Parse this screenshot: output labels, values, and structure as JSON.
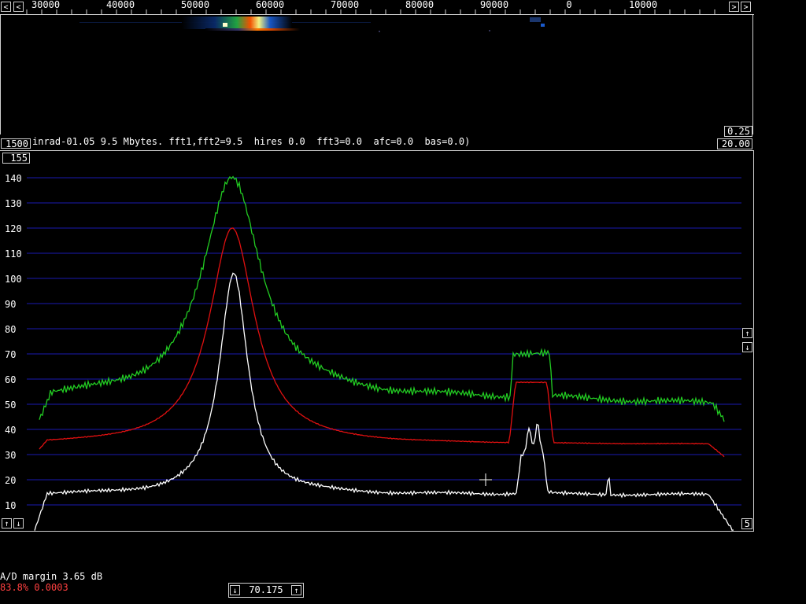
{
  "title_line": "inrad-01.05 9.5 Mbytes. fft1,fft2=9.5  hires 0.0  fft3=0.0  afc=0.0  bas=0.0)",
  "frequency_scale": {
    "labels": [
      "30000",
      "40000",
      "50000",
      "60000",
      "70000",
      "80000",
      "90000",
      "0",
      "10000"
    ],
    "left_arrow": "<",
    "right_arrow": ">"
  },
  "waterfall": {
    "left_box": "1500",
    "right_top_box": "0.25",
    "right_bottom_box": "20.00"
  },
  "spectrum": {
    "top_box": "155",
    "right_box_bottom": "5",
    "up_arrow": "↑",
    "down_arrow": "↓",
    "y_labels": [
      "140",
      "130",
      "120",
      "110",
      "100",
      "90",
      "80",
      "70",
      "60",
      "50",
      "40",
      "30",
      "20",
      "10"
    ],
    "grid_color": "#1a1ab0",
    "series_colors": {
      "green": "#22cc22",
      "red": "#e01010",
      "white": "#ffffff"
    }
  },
  "bottom": {
    "ad_margin": "A/D margin 3.65 dB",
    "cpu_line": "83.8% 0.0003",
    "cpu_color": "#ff4040",
    "freq_value": "70.175"
  }
}
